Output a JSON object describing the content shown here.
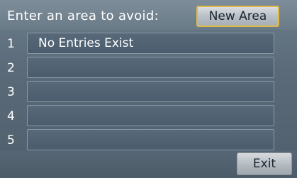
{
  "header": {
    "title": "Enter an area to avoid:",
    "new_area_label": "New Area"
  },
  "list": {
    "rows": [
      {
        "number": "1",
        "text": "No Entries Exist"
      },
      {
        "number": "2",
        "text": ""
      },
      {
        "number": "3",
        "text": ""
      },
      {
        "number": "4",
        "text": ""
      },
      {
        "number": "5",
        "text": ""
      }
    ]
  },
  "footer": {
    "exit_label": "Exit"
  },
  "colors": {
    "highlight_border": "#e0b848",
    "background": "#5a6a78"
  }
}
